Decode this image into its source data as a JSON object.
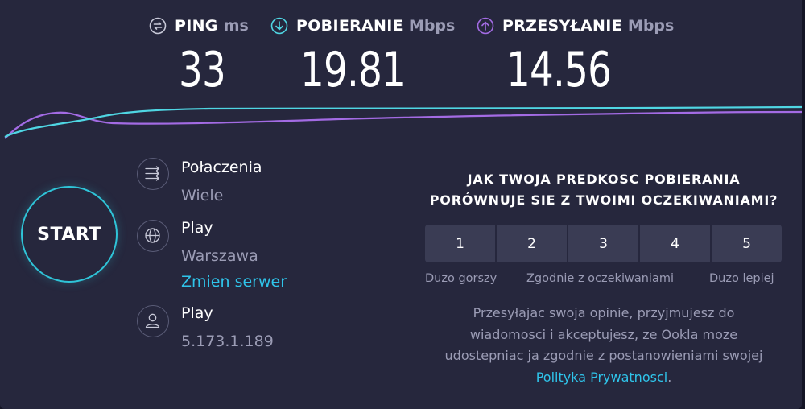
{
  "metrics": {
    "ping": {
      "label": "PING",
      "unit": "ms",
      "value": "33",
      "icon": "ping-icon"
    },
    "download": {
      "label": "POBIERANIE",
      "unit": "Mbps",
      "value": "19.81",
      "icon": "download-arrow-icon"
    },
    "upload": {
      "label": "PRZESYŁANIE",
      "unit": "Mbps",
      "value": "14.56",
      "icon": "upload-arrow-icon"
    }
  },
  "colors": {
    "download": "#4fd6e3",
    "upload": "#a36be4",
    "ping": "#c8c9d8",
    "link": "#2fc4ea",
    "panel": "#26273d",
    "start_ring": "#2fc4d8"
  },
  "start_label": "START",
  "connections": {
    "title": "Połaczenia",
    "value": "Wiele",
    "icon": "connections-icon"
  },
  "server": {
    "title": "Play",
    "location": "Warszawa",
    "change_link": "Zmien serwer",
    "icon": "globe-icon"
  },
  "provider": {
    "title": "Play",
    "ip": "5.173.1.189",
    "icon": "user-icon"
  },
  "survey": {
    "question_line1": "JAK TWOJA PREDKOSC POBIERANIA",
    "question_line2": "PORÓWNUJE SIE Z TWOIMI OCZEKIWANIAMI?",
    "options": [
      "1",
      "2",
      "3",
      "4",
      "5"
    ],
    "label_low": "Duzo gorszy",
    "label_mid": "Zgodnie z oczekiwaniami",
    "label_high": "Duzo lepiej",
    "disclaimer_line1": "Przesyłajac swoja opinie, przyjmujesz do",
    "disclaimer_line2": "wiadomosci i akceptujesz, ze Ookla moze",
    "disclaimer_line3": "udostepniac ja zgodnie z postanowieniami swojej",
    "policy_link": "Polityka Prywatnosci",
    "period": "."
  }
}
